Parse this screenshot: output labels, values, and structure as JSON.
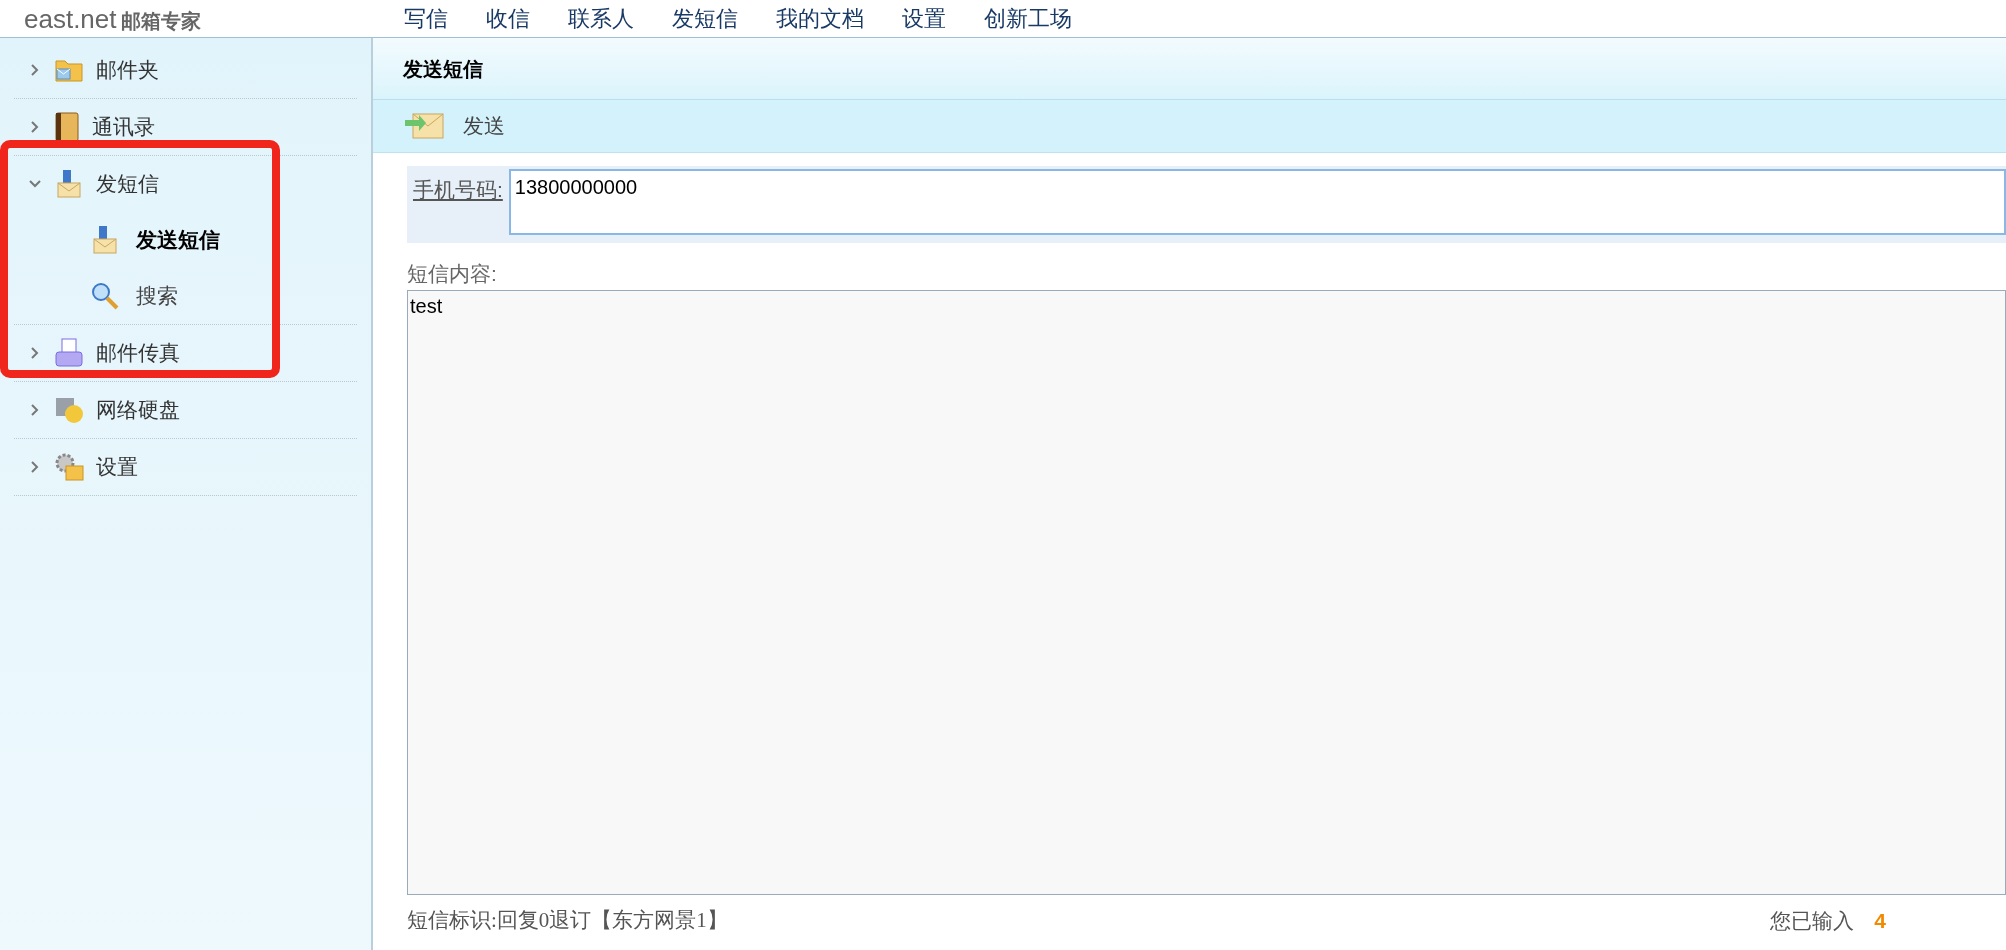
{
  "logo": {
    "brand": "east.net",
    "tagline": "邮箱专家"
  },
  "nav": [
    "写信",
    "收信",
    "联系人",
    "发短信",
    "我的文档",
    "设置",
    "创新工场"
  ],
  "sidebar": {
    "items": [
      {
        "label": "邮件夹",
        "kind": "folder",
        "expanded": false
      },
      {
        "label": "通讯录",
        "kind": "book",
        "expanded": false
      },
      {
        "label": "发短信",
        "kind": "sms",
        "expanded": true,
        "children": [
          {
            "label": "发送短信",
            "kind": "sms",
            "selected": true
          },
          {
            "label": "搜索",
            "kind": "search",
            "selected": false
          }
        ]
      },
      {
        "label": "邮件传真",
        "kind": "fax",
        "expanded": false
      },
      {
        "label": "网络硬盘",
        "kind": "disk",
        "expanded": false
      },
      {
        "label": "设置",
        "kind": "settings",
        "expanded": false
      }
    ]
  },
  "page_title": "发送短信",
  "toolbar": {
    "send": "发送"
  },
  "form": {
    "phone_label": "手机号码:",
    "phone_value": "13800000000",
    "content_label": "短信内容:",
    "content_value": "test"
  },
  "footer": {
    "signature": "短信标识:回复0退订【东方网景1】",
    "count_label": "您已输入",
    "count": "4"
  }
}
